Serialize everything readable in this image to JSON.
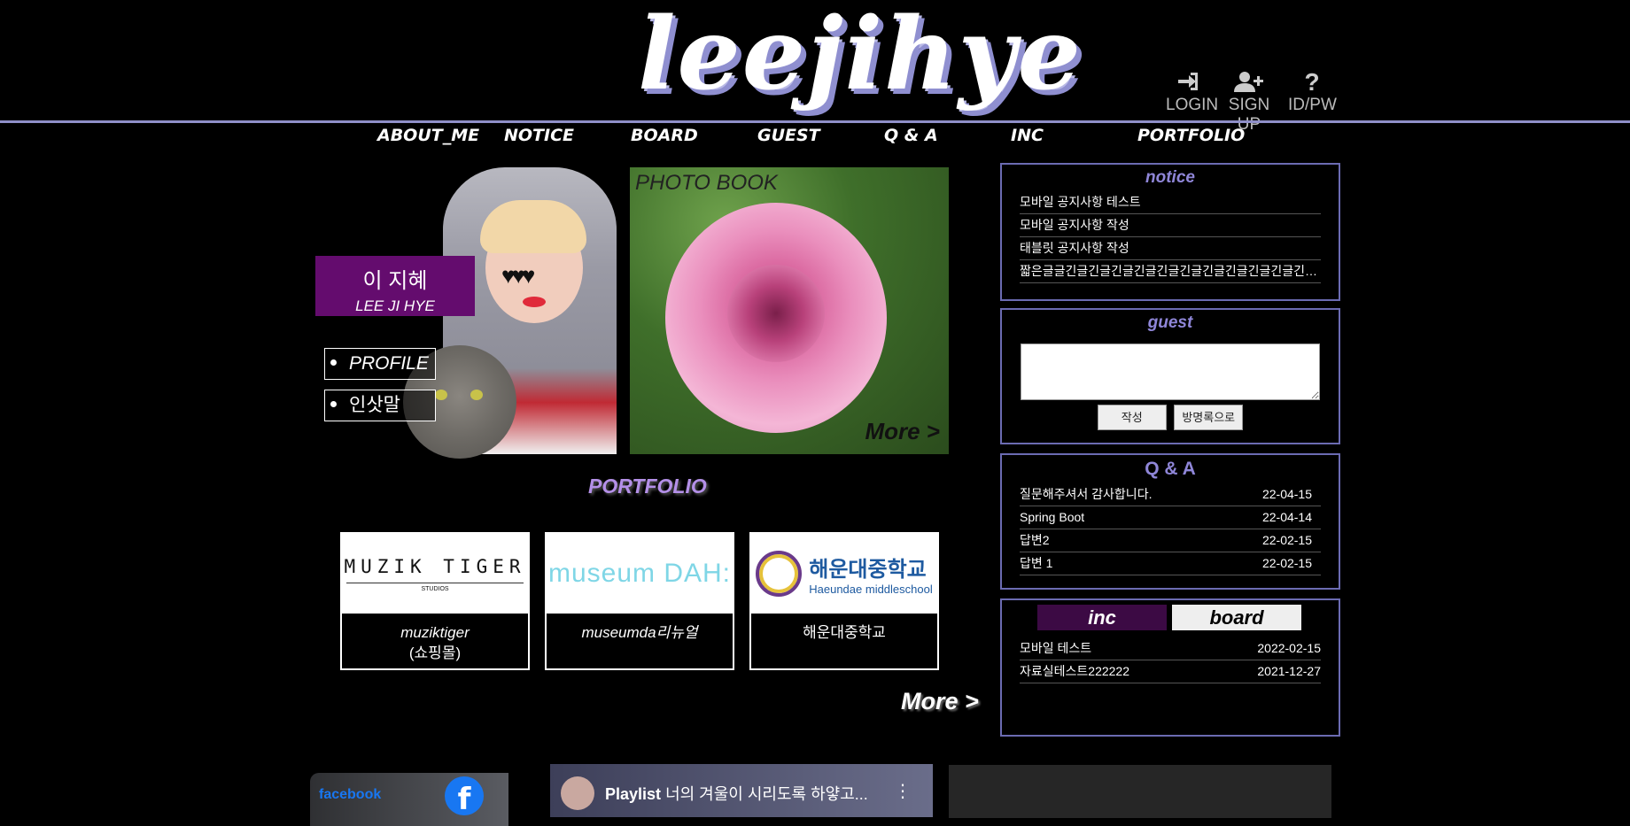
{
  "header": {
    "logo_text": "leejihye",
    "util": [
      {
        "label": "LOGIN",
        "icon": "login-icon"
      },
      {
        "label": "SIGN UP",
        "icon": "add-user-icon"
      },
      {
        "label": "ID/PW",
        "icon": "question-icon"
      }
    ]
  },
  "nav": [
    "ABOUT_ME",
    "NOTICE",
    "BOARD",
    "GUEST",
    "Q & A",
    "INC",
    "PORTFOLIO"
  ],
  "profile": {
    "name_ko": "이 지혜",
    "name_en": "LEE JI HYE",
    "buttons": [
      "PROFILE",
      "인삿말"
    ]
  },
  "photobook": {
    "title": "PHOTO BOOK",
    "more": "More >"
  },
  "portfolio": {
    "title": "PORTFOLIO",
    "items": [
      {
        "logo": "MUZIK TIGER",
        "logo_sub": "STUDIOS",
        "caption1": "muziktiger",
        "caption2": "(쇼핑몰)"
      },
      {
        "logo": "museum DAH:",
        "logo_sub": "",
        "caption1": "museumda리뉴얼",
        "caption2": ""
      },
      {
        "logo": "해운대중학교",
        "logo_sub": "Haeundae middleschool",
        "caption1": "해운대중학교",
        "caption2": ""
      }
    ],
    "more": "More >"
  },
  "notice": {
    "title": "notice",
    "items": [
      "모바일 공지사항 테스트",
      "모바일 공지사항 작성",
      "태블릿 공지사항 작성",
      "짧은글글긴글긴글긴글긴글긴글긴글긴글긴글긴글긴글긴글긴글긴글긴..."
    ]
  },
  "guest": {
    "title": "guest",
    "write_button": "작성",
    "goto_button": "방명록으로"
  },
  "qa": {
    "title": "Q & A",
    "items": [
      {
        "title": "질문해주셔서 감사합니다.",
        "date": "22-04-15"
      },
      {
        "title": "Spring Boot",
        "date": "22-04-14"
      },
      {
        "title": "답변2",
        "date": "22-02-15"
      },
      {
        "title": "답변 1",
        "date": "22-02-15"
      }
    ]
  },
  "inc_board": {
    "tabs": [
      "inc",
      "board"
    ],
    "active_tab": "inc",
    "items": [
      {
        "title": "모바일 테스트",
        "date": "2022-02-15"
      },
      {
        "title": "자료실테스트222222",
        "date": "2021-12-27"
      }
    ]
  },
  "footer": {
    "facebook": "facebook",
    "playlist_label": "Playlist",
    "playlist_title": "너의 겨울이 시리도록 하얗고..."
  },
  "colors": {
    "accent_purple": "#640c6e",
    "box_border": "#6b6bb2",
    "title_purple": "#8f86d8",
    "facebook_blue": "#1877f2"
  }
}
